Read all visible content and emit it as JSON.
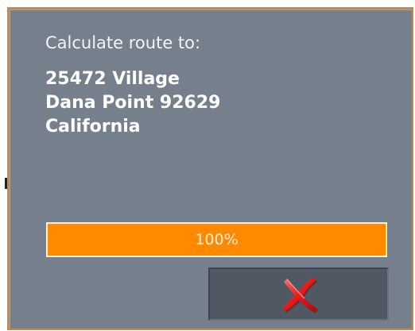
{
  "dialog": {
    "heading": "Calculate route to:",
    "address_lines": [
      "25472 Village",
      "Dana Point 92629",
      "California"
    ],
    "progress": {
      "value_percent": 100,
      "label": "100%"
    },
    "cancel_button": {
      "icon": "close-icon"
    }
  },
  "colors": {
    "dialog_background": "#76808d",
    "dialog_border": "#c9893f",
    "progress_fill": "#ff8a00",
    "button_background": "#505963",
    "close_icon": "#e02020"
  }
}
